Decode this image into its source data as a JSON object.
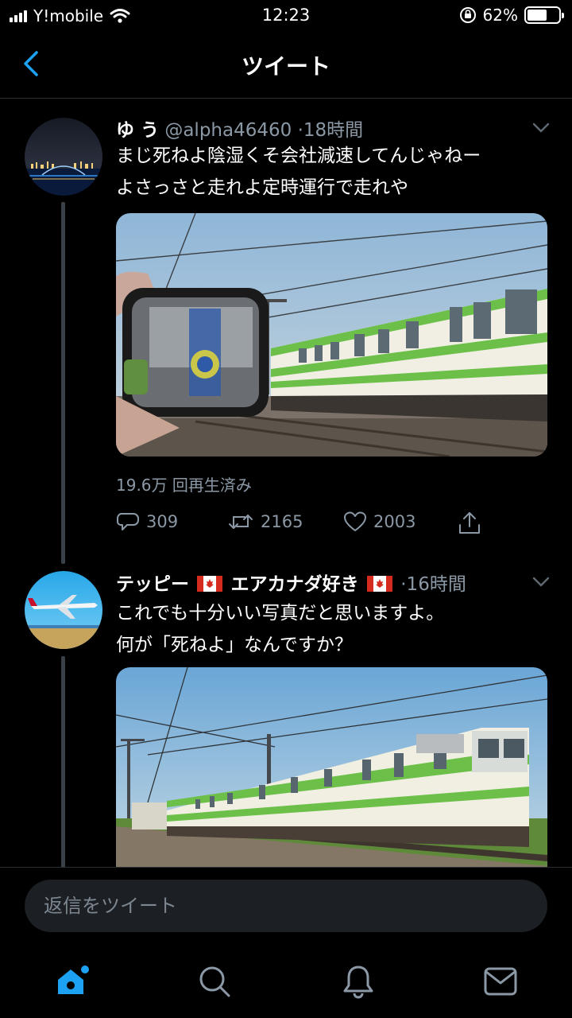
{
  "status_bar": {
    "carrier": "Y!mobile",
    "time": "12:23",
    "battery": "62%",
    "battery_level": 0.62
  },
  "nav": {
    "title": "ツイート"
  },
  "tweets": [
    {
      "name": "ゆ う",
      "handle": "@alpha46460",
      "time": "·18時間",
      "text_line1": "まじ死ねよ陰湿くそ会社減速してんじゃねー",
      "text_line2": "よさっさと走れよ定時運行で走れや",
      "views": "19.6万 回再生済み",
      "replies": "309",
      "retweets": "2165",
      "likes": "2003"
    },
    {
      "name_part1": "テッピー",
      "name_part2": "エアカナダ好き",
      "time": "·16時間",
      "text_line1": "これでも十分いい写真だと思いますよ。",
      "text_line2": "何が「死ねよ」なんですか？"
    }
  ],
  "reply": {
    "placeholder": "返信をツイート"
  },
  "colors": {
    "accent": "#1da1f2",
    "muted": "#8b98a5",
    "background": "#000000",
    "train_green": "#6cc04a"
  },
  "tabs": [
    "home-icon",
    "search-icon",
    "notifications-icon",
    "messages-icon"
  ]
}
